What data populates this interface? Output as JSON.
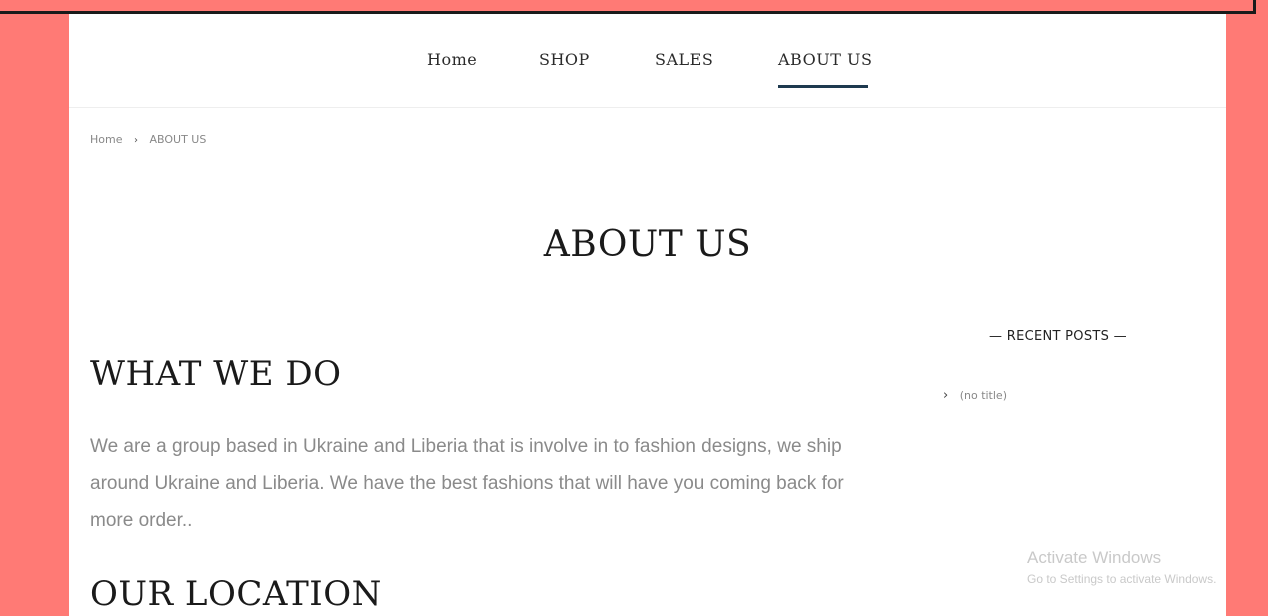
{
  "nav": {
    "items": [
      {
        "label": "Home"
      },
      {
        "label": "SHOP"
      },
      {
        "label": "SALES"
      },
      {
        "label": "ABOUT US"
      }
    ]
  },
  "breadcrumb": {
    "home": "Home",
    "separator": "›",
    "current": "ABOUT US"
  },
  "page_title": "ABOUT US",
  "sections": {
    "what_we_do": {
      "heading": "WHAT WE DO",
      "text": "We are a group based in Ukraine and Liberia that is involve in to fashion designs, we ship around Ukraine and Liberia. We have the best fashions that will have you coming back for more order.."
    },
    "our_location": {
      "heading": "OUR LOCATION"
    }
  },
  "sidebar": {
    "title": "— RECENT POSTS —",
    "posts": [
      {
        "chevron": "›",
        "label": "(no title)"
      }
    ]
  },
  "watermark": {
    "line1": "Activate Windows",
    "line2": "Go to Settings to activate Windows."
  },
  "colors": {
    "background": "#ff7a75",
    "accent_underline": "#1e3a4f"
  }
}
